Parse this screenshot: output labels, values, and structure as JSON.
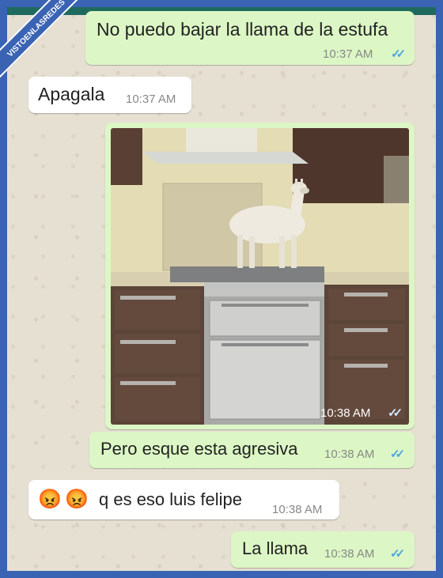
{
  "watermark": "VISTOENLASREDES",
  "messages": [
    {
      "text": "No puedo bajar la llama de la estufa",
      "time": "10:37 AM",
      "ticks": "✓✓"
    },
    {
      "text": "Apagala",
      "time": "10:37 AM"
    },
    {
      "image": "llama standing on a kitchen stove",
      "time": "10:38 AM",
      "ticks": "✓✓"
    },
    {
      "text": "Pero esque esta agresiva",
      "time": "10:38 AM",
      "ticks": "✓✓"
    },
    {
      "emojis": [
        "😡",
        "😡"
      ],
      "text": "q es eso luis felipe",
      "time": "10:38 AM"
    },
    {
      "text": "La llama",
      "time": "10:38 AM",
      "ticks": "✓✓"
    }
  ],
  "colors": {
    "outgoing": "#dcf7c5",
    "incoming": "#ffffff",
    "ticks": "#4fa6dd",
    "frame": "#3a63b3"
  }
}
